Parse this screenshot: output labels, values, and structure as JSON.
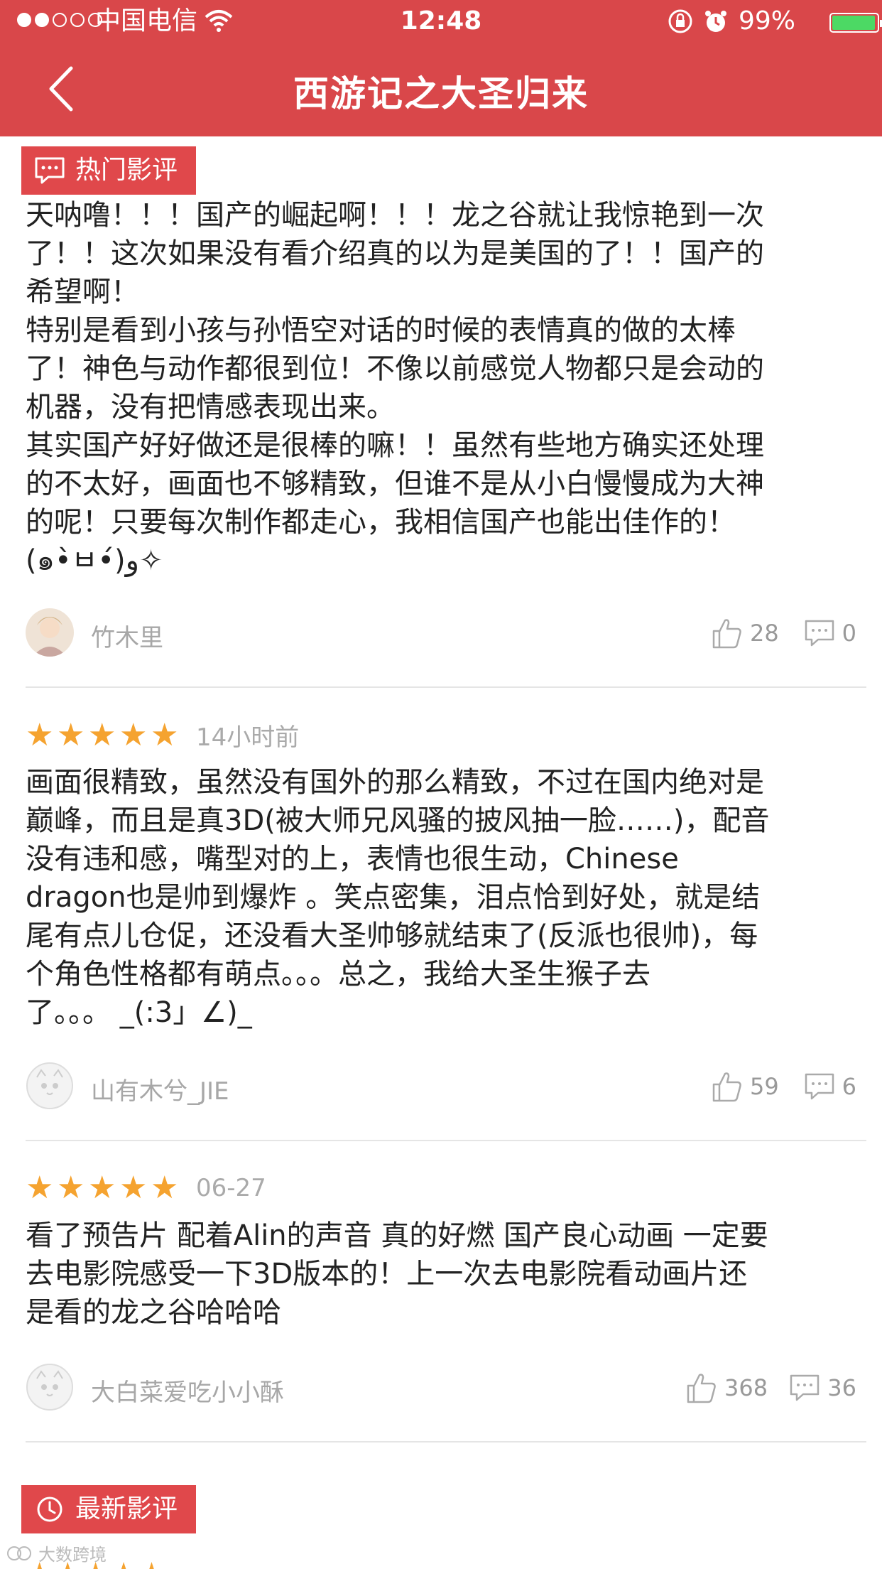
{
  "status_bar": {
    "carrier": "中国电信",
    "time": "12:48",
    "battery": "99%"
  },
  "nav": {
    "title": "西游记之大圣归来"
  },
  "sections": {
    "hot": "热门影评",
    "latest": "最新影评"
  },
  "reviews": [
    {
      "lines": [
        "天呐噜！！！国产的崛起啊！！！龙之谷就让我惊艳到一次",
        "了！！这次如果没有看介绍真的以为是美国的了！！国产的",
        "希望啊！",
        "特别是看到小孩与孙悟空对话的时候的表情真的做的太棒",
        "了！神色与动作都很到位！不像以前感觉人物都只是会动的",
        "机器，没有把情感表现出来。",
        "其实国产好好做还是很棒的嘛！！虽然有些地方确实还处理",
        "的不太好，画面也不够精致，但谁不是从小白慢慢成为大神",
        "的呢！只要每次制作都走心，我相信国产也能出佳作的！",
        "(๑•̀ㅂ•́)و✧"
      ],
      "username": "竹木里",
      "likes": "28",
      "comments": "0"
    },
    {
      "stars": "★★★★★",
      "time": "14小时前",
      "lines": [
        "画面很精致，虽然没有国外的那么精致，不过在国内绝对是",
        "巅峰，而且是真3D(被大师兄风骚的披风抽一脸……)，配音",
        "没有违和感，嘴型对的上，表情也很生动，Chinese",
        "dragon也是帅到爆炸 。笑点密集，泪点恰到好处，就是结",
        "尾有点儿仓促，还没看大圣帅够就结束了(反派也很帅)，每",
        "个角色性格都有萌点。。。总之，我给大圣生猴子去",
        "了。。。 _(:3」∠)_"
      ],
      "username": "山有木兮_JIE",
      "likes": "59",
      "comments": "6"
    },
    {
      "stars": "★★★★★",
      "time": "06-27",
      "lines": [
        "看了预告片 配着Alin的声音 真的好燃 国产良心动画 一定要",
        "去电影院感受一下3D版本的！上一次去电影院看动画片还",
        "是看的龙之谷哈哈哈"
      ],
      "username": "大白菜爱吃小小酥",
      "likes": "368",
      "comments": "36"
    }
  ],
  "watermark": "大数跨境",
  "colors": {
    "header": "#d9474a",
    "tag": "#e0484b",
    "star": "#f5a330",
    "meta": "#a7a7a7"
  }
}
